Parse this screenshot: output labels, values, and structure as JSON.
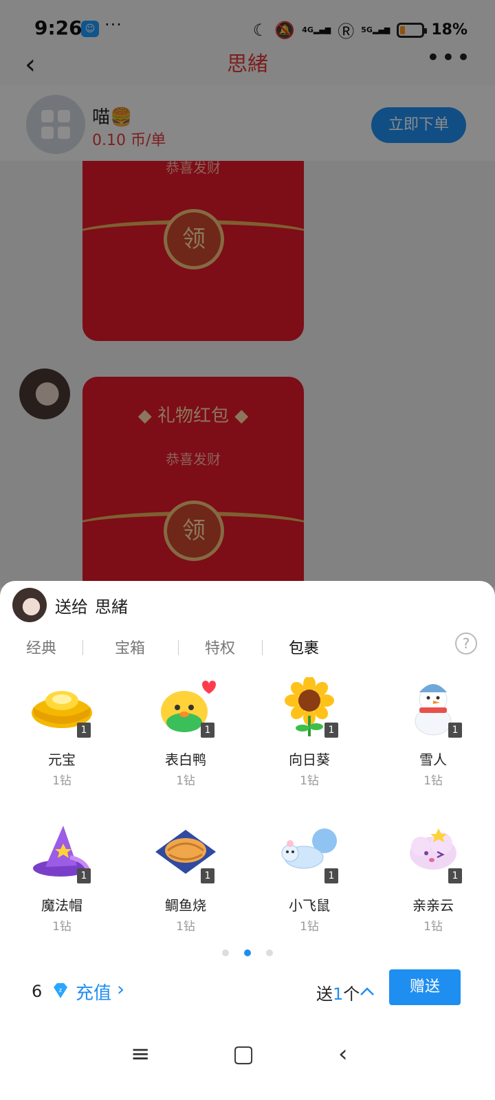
{
  "status": {
    "time": "9:26",
    "app_badge": "☺",
    "dots": "···",
    "net4g": "4G",
    "net5g": "5G",
    "battery": "18%"
  },
  "header": {
    "title": "思緒"
  },
  "order": {
    "name": "喵🍔",
    "price": "0.10 币/单",
    "button": "立即下单"
  },
  "chat": {
    "packet1": {
      "sub": "恭喜发财",
      "coin": "领"
    },
    "packet2": {
      "title": "◆ 礼物红包 ◆",
      "sub": "恭喜发财",
      "coin": "领"
    }
  },
  "sheet": {
    "send_to_label": "送给",
    "send_to_name": "思緒",
    "tabs": [
      {
        "label": "经典"
      },
      {
        "label": "宝箱"
      },
      {
        "label": "特权"
      },
      {
        "label": "包裹"
      }
    ],
    "active_tab": 3,
    "help": "?",
    "gifts": [
      {
        "name": "元宝",
        "price": "1钻",
        "count": "1"
      },
      {
        "name": "表白鸭",
        "price": "1钻",
        "count": "1"
      },
      {
        "name": "向日葵",
        "price": "1钻",
        "count": "1"
      },
      {
        "name": "雪人",
        "price": "1钻",
        "count": "1"
      },
      {
        "name": "魔法帽",
        "price": "1钻",
        "count": "1"
      },
      {
        "name": "鲷鱼烧",
        "price": "1钻",
        "count": "1"
      },
      {
        "name": "小飞鼠",
        "price": "1钻",
        "count": "1"
      },
      {
        "name": "亲亲云",
        "price": "1钻",
        "count": "1"
      }
    ],
    "page_total": 3,
    "page_current": 2,
    "balance": "6",
    "recharge": "充值",
    "send_prefix": "送",
    "send_num": "1",
    "send_suffix": "个",
    "send_button": "赠送"
  },
  "colors": {
    "accent": "#1f8ef1",
    "title_red": "#e23a3a",
    "packet_red": "#e3192b"
  }
}
